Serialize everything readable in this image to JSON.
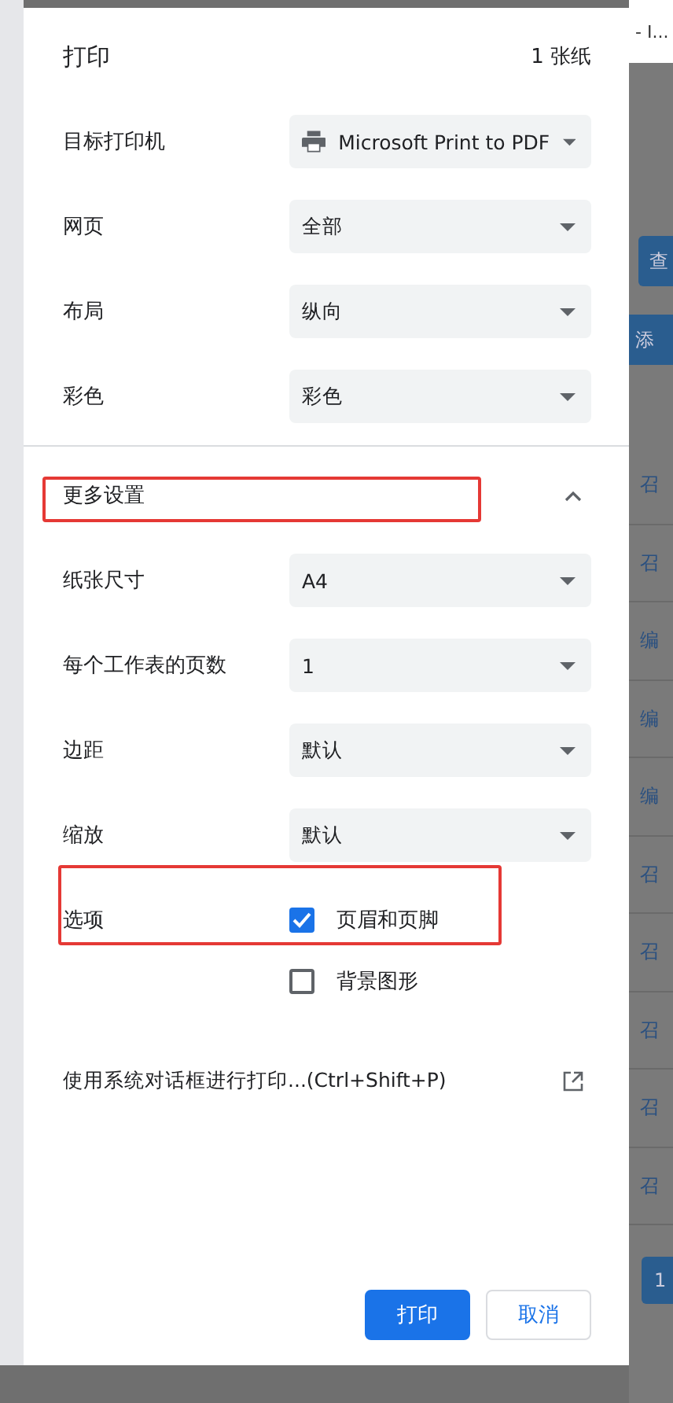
{
  "background_page": {
    "tab_title": "- I...",
    "search_button": "查",
    "add_bar": "添",
    "rows": [
      "召",
      "召",
      "编",
      "编",
      "编",
      "召",
      "召",
      "召",
      "召",
      "召"
    ],
    "page_button": "1"
  },
  "dialog": {
    "title": "打印",
    "sheet_count": "1 张纸",
    "settings": [
      {
        "label": "目标打印机",
        "value": "Microsoft Print to PDF",
        "kind": "printer"
      },
      {
        "label": "网页",
        "value": "全部",
        "kind": "select"
      },
      {
        "label": "布局",
        "value": "纵向",
        "kind": "select"
      },
      {
        "label": "彩色",
        "value": "彩色",
        "kind": "select"
      }
    ],
    "more_settings": {
      "label": "更多设置",
      "expanded": true,
      "highlighted": true
    },
    "more": [
      {
        "label": "纸张尺寸",
        "value": "A4"
      },
      {
        "label": "每个工作表的页数",
        "value": "1"
      },
      {
        "label": "边距",
        "value": "默认"
      },
      {
        "label": "缩放",
        "value": "默认"
      }
    ],
    "options": {
      "label": "选项",
      "highlighted": true,
      "items": [
        {
          "label": "页眉和页脚",
          "checked": true
        },
        {
          "label": "背景图形",
          "checked": false
        }
      ]
    },
    "system_dialog_link": "使用系统对话框进行打印...(Ctrl+Shift+P)",
    "buttons": [
      {
        "label": "打印",
        "kind": "primary"
      },
      {
        "label": "取消",
        "kind": "secondary"
      }
    ]
  }
}
